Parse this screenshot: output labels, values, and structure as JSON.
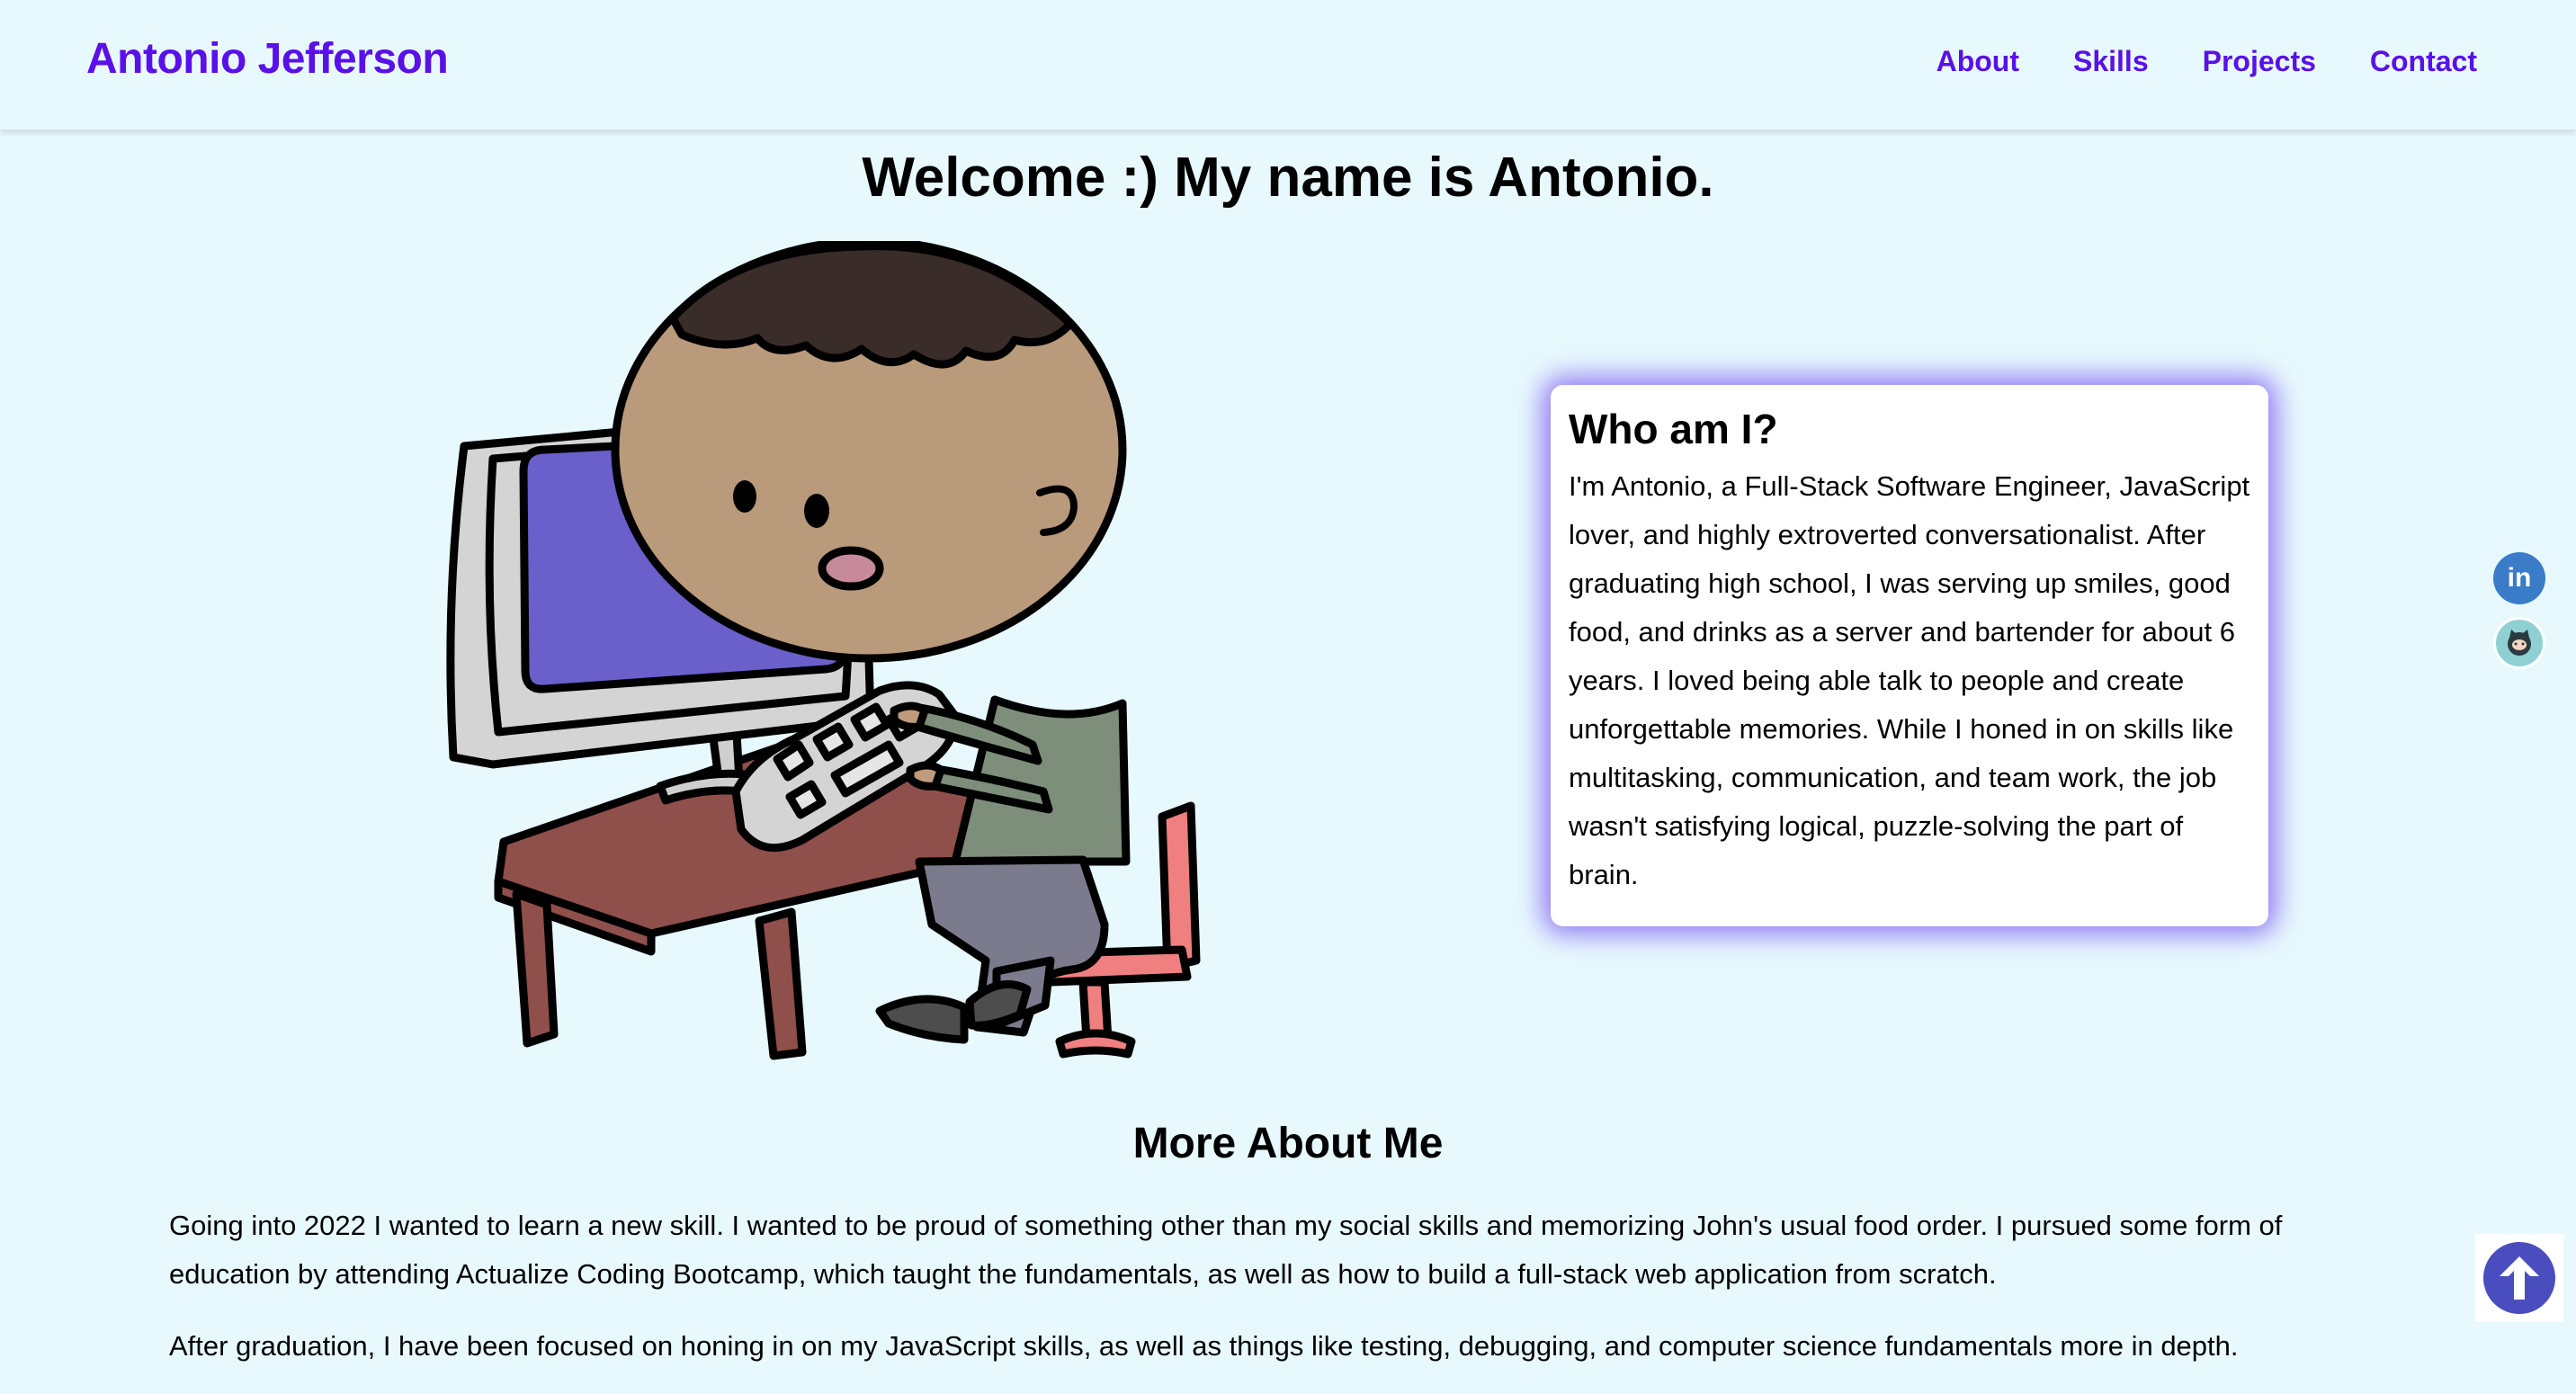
{
  "nav": {
    "brand": "Antonio Jefferson",
    "links": [
      "About",
      "Skills",
      "Projects",
      "Contact"
    ]
  },
  "hero": {
    "welcome": "Welcome :) My name is Antonio."
  },
  "who": {
    "title": "Who am I?",
    "text": "I'm Antonio, a Full-Stack Software Engineer, JavaScript lover, and highly extroverted conversationalist. After graduating high school, I was serving up smiles, good food, and drinks as a server and bartender for about 6 years. I loved being able talk to people and create unforgettable memories. While I honed in on skills like multitasking, communication, and team work, the job wasn't satisfying logical, puzzle-solving the part of brain."
  },
  "more": {
    "title": "More About Me",
    "paragraphs": [
      "Going into 2022 I wanted to learn a new skill. I wanted to be proud of something other than my social skills and memorizing John's usual food order. I pursued some form of education by attending Actualize Coding Bootcamp, which taught the fundamentals, as well as how to build a full-stack web application from scratch.",
      "After graduation, I have been focused on honing in on my JavaScript skills, as well as things like testing, debugging, and computer science fundamentals more in depth."
    ]
  },
  "socials": {
    "linkedin_icon": "linkedin-icon",
    "linkedin_glyph": "in",
    "github_icon": "github-icon"
  },
  "colors": {
    "background": "#e8f9fd",
    "accent": "#5a10e8",
    "card_glow": "#6e46f0",
    "scroll_button": "#4a4dbd"
  }
}
